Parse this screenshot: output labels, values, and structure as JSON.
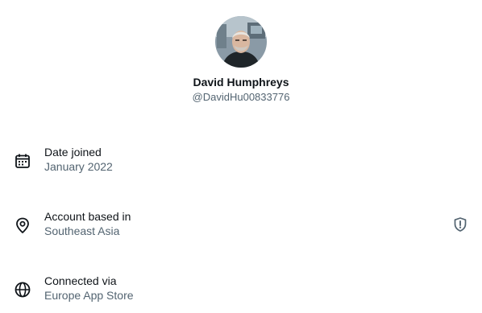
{
  "profile": {
    "display_name": "David Humphreys",
    "handle": "@DavidHu00833776"
  },
  "about": {
    "date_joined": {
      "label": "Date joined",
      "value": "January 2022",
      "icon": "calendar-icon"
    },
    "account_based_in": {
      "label": "Account based in",
      "value": "Southeast Asia",
      "icon": "location-pin-icon",
      "trailing_icon": "shield-alert-icon"
    },
    "connected_via": {
      "label": "Connected via",
      "value": "Europe App Store",
      "icon": "globe-icon"
    }
  },
  "colors": {
    "primary_text": "#0f1419",
    "secondary_text": "#536471"
  }
}
